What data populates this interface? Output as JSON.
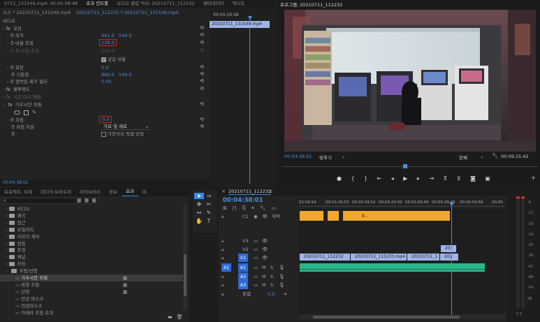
{
  "effect_controls": {
    "tabs": [
      "0711_131549.mp4: 00:05:08:48",
      "효과 컨트롤",
      "오디오 클립 믹서: 20210711_112232",
      "메타데이터",
      "텍스트"
    ],
    "source_line": "소스 * 20210711_131549.mp4",
    "sequence_link": "20210711_112232 * 20210711_131549.mp4",
    "section_video": "비디오",
    "motion": "모션",
    "position_label": "위치",
    "position_x": "941.0",
    "position_y": "540.0",
    "scale_label": "비율 조정",
    "scale_value": "128.0",
    "scale_width_label": "폭 비율 조정",
    "scale_width_value": "100.0",
    "uniform_scale_label": "균일 비율",
    "rotation_label": "회전",
    "rotation_value": "0.0",
    "anchor_label": "기준점",
    "anchor_x": "960.0",
    "anchor_y": "540.0",
    "flicker_label": "깜박임 제거 필터",
    "flicker_value": "0.00",
    "opacity_label": "불투명도",
    "time_remap_label": "시간 다시 매핑",
    "blur_label": "가우시안 흐림",
    "blurriness_label": "흐림",
    "blurriness_value": "0.0",
    "blur_dimensions_label": "흐림 차원",
    "blur_dimensions_value": "가로 및 세로",
    "repeat_edge_label": "가장자리 픽셀 반복",
    "timecode": "00:04:38:01",
    "mini_timeline_time": "00:04:29:48",
    "mini_clip": "20210711_131549.mp4"
  },
  "program_monitor": {
    "title": "프로그램: 20210711_112232",
    "timecode": "00:04:38:01",
    "fit": "맞추기",
    "quality": "전체",
    "duration": "00:09:15:42"
  },
  "effects_panel": {
    "tabs": [
      "프로젝트: 무제",
      "미디어 브라우저",
      "라이브러리",
      "정보",
      "효과",
      "마"
    ],
    "items": [
      {
        "label": "비디오",
        "indent": 1,
        "kind": "folder"
      },
      {
        "label": "왜곡",
        "indent": 1,
        "kind": "folder"
      },
      {
        "label": "원근",
        "indent": 1,
        "kind": "folder"
      },
      {
        "label": "유틸리티",
        "indent": 1,
        "kind": "folder"
      },
      {
        "label": "이미지 제어",
        "indent": 1,
        "kind": "folder"
      },
      {
        "label": "전환",
        "indent": 1,
        "kind": "folder"
      },
      {
        "label": "조정",
        "indent": 1,
        "kind": "folder"
      },
      {
        "label": "채널",
        "indent": 1,
        "kind": "folder"
      },
      {
        "label": "키잉",
        "indent": 1,
        "kind": "folder"
      },
      {
        "label": "흐림/선명",
        "indent": 1,
        "kind": "folder-open"
      },
      {
        "label": "가우시안 흐림",
        "indent": 2,
        "kind": "effect",
        "selected": true
      },
      {
        "label": "방향 흐림",
        "indent": 2,
        "kind": "effect"
      },
      {
        "label": "선명",
        "indent": 2,
        "kind": "effect"
      },
      {
        "label": "언샵 마스크",
        "indent": 2,
        "kind": "effect"
      },
      {
        "label": "언샵마스크",
        "indent": 2,
        "kind": "effect"
      },
      {
        "label": "카메라 흐림 효과",
        "indent": 2,
        "kind": "effect"
      }
    ]
  },
  "timeline": {
    "sequence_tab": "20210711_112232",
    "timecode": "00:04:38:01",
    "ruler": [
      "01:59:54",
      "00:02:29:53",
      "00:02:59:52",
      "00:03:29:50",
      "00:03:59:49",
      "00:04:29:48",
      "00:04:59:46",
      "00:05"
    ],
    "tracks": {
      "c1": "C1",
      "caption_label": "자막",
      "caption_clip": "9...",
      "v3": "V3",
      "v2": "V2",
      "v1": "V1",
      "a1_src": "A1",
      "a1": "A1",
      "a2": "A2",
      "a3": "A3",
      "m": "M",
      "s": "S",
      "mix": "혼합",
      "mix_value": "0.0"
    },
    "clips": {
      "v1_a": "20210711_112232",
      "v1_b": "20210711_115233.mp4",
      "v1_c": "20210711_1",
      "v1_d": "202",
      "v2_a": "20"
    }
  },
  "audio_meter": {
    "labels": [
      "-6",
      "-12",
      "-18",
      "-24",
      "-30",
      "-36",
      "-42",
      "-48",
      "-54",
      "dB"
    ],
    "footer": "S S"
  },
  "colors": {
    "accent": "#2d8ceb",
    "clip_video": "#9fb3e8",
    "clip_audio": "#2bb58a",
    "caption": "#f1a82c",
    "playhead": "#4a8fe0"
  }
}
